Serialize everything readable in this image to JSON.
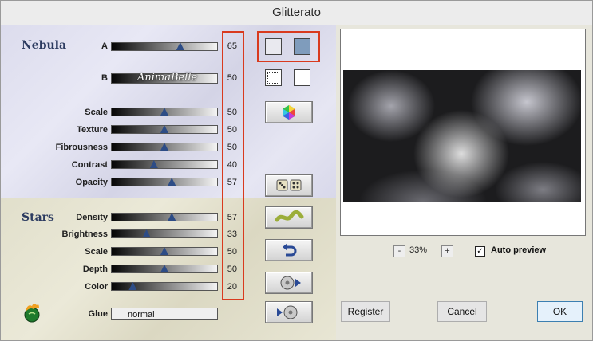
{
  "window": {
    "title": "Glitterato"
  },
  "nebula": {
    "section_label": "Nebula",
    "rows": [
      {
        "label": "A",
        "value": 65
      },
      {
        "label": "B",
        "value": 50,
        "preset_label": "AnimaBelle"
      },
      {
        "label": "Scale",
        "value": 50
      },
      {
        "label": "Texture",
        "value": 50
      },
      {
        "label": "Fibrousness",
        "value": 50
      },
      {
        "label": "Contrast",
        "value": 40
      },
      {
        "label": "Opacity",
        "value": 57
      }
    ]
  },
  "stars": {
    "section_label": "Stars",
    "rows": [
      {
        "label": "Density",
        "value": 57
      },
      {
        "label": "Brightness",
        "value": 33
      },
      {
        "label": "Scale",
        "value": 50
      },
      {
        "label": "Depth",
        "value": 50
      },
      {
        "label": "Color",
        "value": 20
      }
    ]
  },
  "glue": {
    "label": "Glue",
    "value": "normal"
  },
  "colors": {
    "swatch_1": "#e9e9ef",
    "swatch_2": "#7f9cbc",
    "swatch_3": "#ffffff",
    "swatch_4": "#ffffff",
    "highlight": "#d93a1e"
  },
  "buttons": {
    "color_picker_icon": "hexagon-color-icon",
    "random_icon": "dice-icon",
    "wave_icon": "wave-icon",
    "reset_icon": "undo-arrow-icon",
    "preset_load_icon": "disc-play-icon",
    "preset_save_icon": "play-disc-icon",
    "register": "Register",
    "cancel": "Cancel",
    "ok": "OK"
  },
  "preview": {
    "zoom": "33%",
    "zoom_minus": "-",
    "zoom_plus": "+",
    "auto_preview_label": "Auto preview",
    "auto_preview_checked": true
  }
}
